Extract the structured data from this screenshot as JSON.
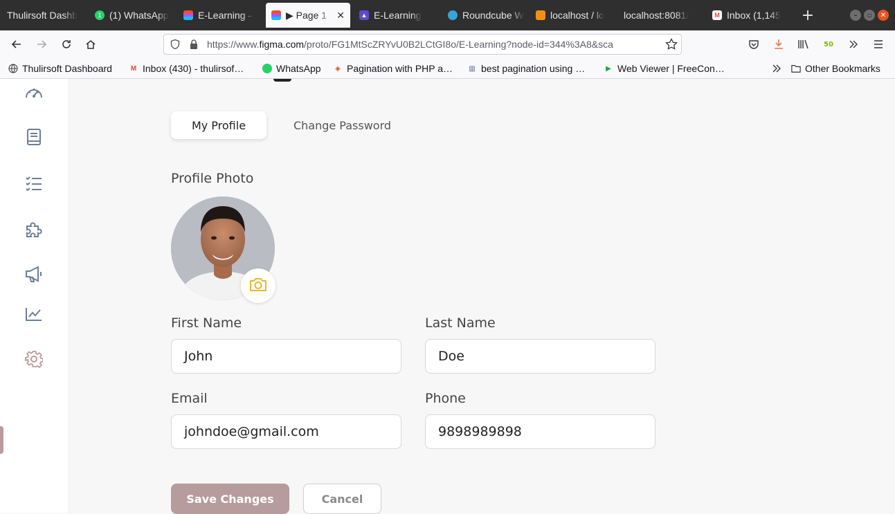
{
  "browser": {
    "tabs": [
      {
        "label": "Thulirsoft Dashb",
        "icon": "dashboard-favicon"
      },
      {
        "label": "(1) WhatsApp",
        "icon": "whatsapp-favicon",
        "color": "#25d366"
      },
      {
        "label": "E-Learning –",
        "icon": "figma-favicon"
      },
      {
        "label": "▶ Page 1 -",
        "icon": "figma-favicon",
        "active": true
      },
      {
        "label": "E-Learning",
        "icon": "app-favicon",
        "color": "#5b4ccc"
      },
      {
        "label": "Roundcube W",
        "icon": "roundcube-favicon"
      },
      {
        "label": "localhost / lo",
        "icon": "phpmyadmin-favicon"
      },
      {
        "label": "localhost:8081/",
        "icon": "blank-favicon"
      },
      {
        "label": "Inbox (1,145",
        "icon": "gmail-favicon"
      }
    ],
    "url": {
      "prefix": "https://www.",
      "domain": "figma.com",
      "path": "/proto/FG1MtScZRYvU0B2LCtGI8o/E-Learning?node-id=344%3A8&sca"
    },
    "bookmarks": [
      {
        "label": "Thulirsoft Dashboard",
        "icon": "globe-icon"
      },
      {
        "label": "Inbox (430) - thulirsof…",
        "icon": "gmail-icon"
      },
      {
        "label": "WhatsApp",
        "icon": "whatsapp-icon"
      },
      {
        "label": "Pagination with PHP a…",
        "icon": "codeigniter-icon"
      },
      {
        "label": "best pagination using …",
        "icon": "php-icon"
      },
      {
        "label": "Web Viewer | FreeCon…",
        "icon": "play-icon"
      }
    ],
    "other_bookmarks": "Other Bookmarks",
    "extension_badge": "50",
    "colors": {
      "accent": "#e95420",
      "download": "#e8774a"
    }
  },
  "sidebar": {
    "items": [
      {
        "name": "dashboard",
        "icon": "speedometer-icon"
      },
      {
        "name": "courses",
        "icon": "book-icon"
      },
      {
        "name": "tasks",
        "icon": "checklist-icon"
      },
      {
        "name": "modules",
        "icon": "puzzle-icon"
      },
      {
        "name": "announcements",
        "icon": "megaphone-icon"
      },
      {
        "name": "reports",
        "icon": "chart-line-icon"
      },
      {
        "name": "settings",
        "icon": "gear-icon",
        "active": true
      }
    ],
    "active_color": "#b99b9c"
  },
  "profile": {
    "tabs": {
      "my_profile": "My Profile",
      "change_password": "Change Password"
    },
    "photo_title": "Profile Photo",
    "fields": {
      "first_name": {
        "label": "First Name",
        "value": "John"
      },
      "last_name": {
        "label": "Last Name",
        "value": "Doe"
      },
      "email": {
        "label": "Email",
        "value": "johndoe@gmail.com"
      },
      "phone": {
        "label": "Phone",
        "value": "9898989898"
      }
    },
    "buttons": {
      "save": "Save Changes",
      "cancel": "Cancel"
    },
    "colors": {
      "primary": "#b79c9d",
      "camera": "#e5b82b"
    }
  }
}
